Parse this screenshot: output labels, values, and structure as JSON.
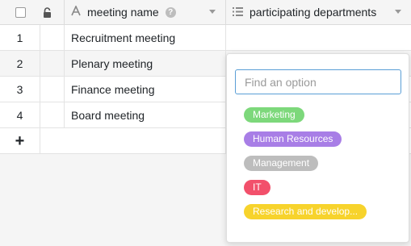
{
  "header": {
    "name_col": "meeting name",
    "dept_col": "participating departments",
    "help_glyph": "?"
  },
  "rows": [
    {
      "num": "1",
      "name": "Recruitment meeting"
    },
    {
      "num": "2",
      "name": "Plenary meeting"
    },
    {
      "num": "3",
      "name": "Finance meeting"
    },
    {
      "num": "4",
      "name": "Board meeting"
    }
  ],
  "add_glyph": "+",
  "popup": {
    "placeholder": "Find an option",
    "options": [
      {
        "label": "Marketing",
        "color": "#7dd87b"
      },
      {
        "label": "Human Resources",
        "color": "#a87ee6"
      },
      {
        "label": "Management",
        "color": "#bdbdbd"
      },
      {
        "label": "IT",
        "color": "#f2506b"
      },
      {
        "label": "Research and develop...",
        "color": "#f7d32c"
      }
    ]
  },
  "icons": {
    "text_field": "text-type-icon",
    "lock": "lock-icon",
    "list": "multi-select-icon"
  }
}
